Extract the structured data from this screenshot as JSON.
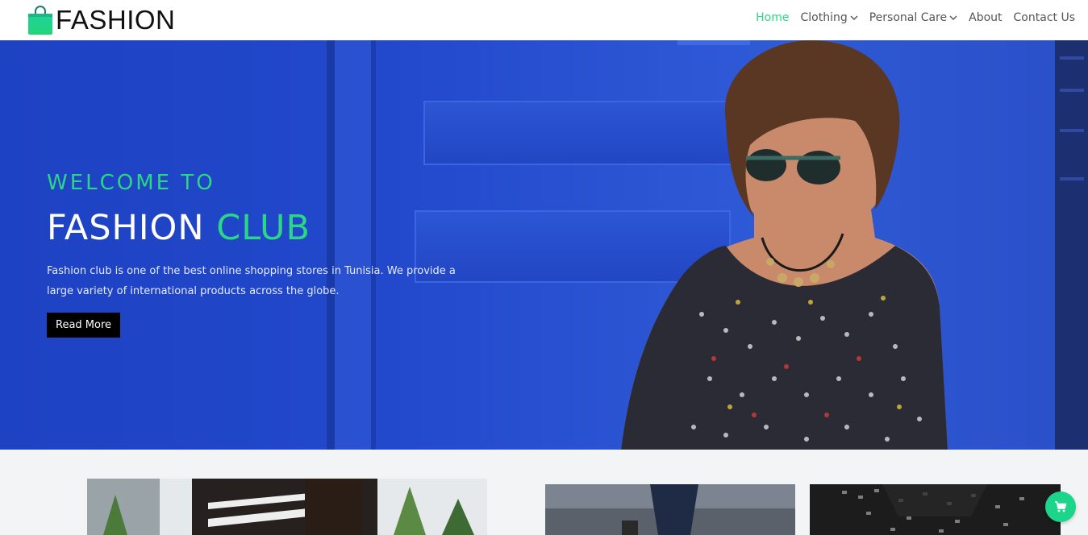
{
  "brand": {
    "name": "FASHION",
    "icon": "shopping-bag-icon",
    "accent_color": "#2bd684"
  },
  "nav": {
    "items": [
      {
        "label": "Home",
        "active": true
      },
      {
        "label": "Clothing",
        "has_dropdown": true
      },
      {
        "label": "Personal Care",
        "has_dropdown": true
      },
      {
        "label": "About"
      },
      {
        "label": "Contact Us"
      }
    ]
  },
  "hero": {
    "welcome": "WELCOME TO",
    "title_main": "FASHION",
    "title_accent": "CLUB",
    "description": "Fashion club is one of the best online shopping stores in Tunisia. We provide a large variety of international products across the globe.",
    "button_label": "Read More",
    "background_color": "#1f45c7"
  },
  "cart": {
    "icon": "cart-icon",
    "color": "#1dd58a"
  }
}
